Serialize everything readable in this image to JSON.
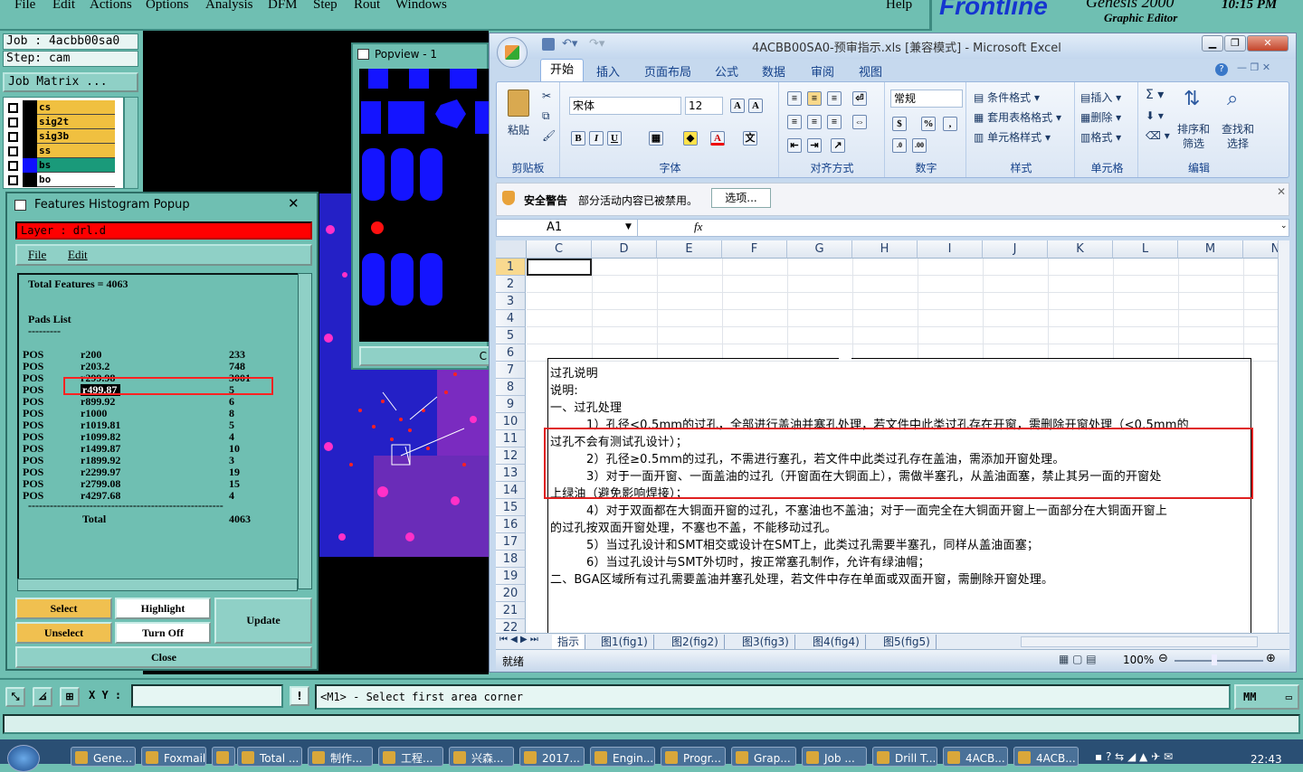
{
  "menubar": {
    "items": [
      "File",
      "Edit",
      "Actions",
      "Options",
      "Analysis",
      "DFM",
      "Step",
      "Rout",
      "Windows"
    ],
    "help": "Help"
  },
  "brand": {
    "logo": "Frontline",
    "product": "Genesis 2000",
    "subtitle": "Graphic Editor",
    "time": "10:15 PM"
  },
  "job": {
    "job": "Job : 4acbb00sa0",
    "step": "Step: cam",
    "matrix_button": "Job Matrix ...",
    "layers": [
      {
        "name": "cs",
        "swatch": "#000000",
        "bg": "#f0c040"
      },
      {
        "name": "sig2t",
        "swatch": "#000000",
        "bg": "#f0c040"
      },
      {
        "name": "sig3b",
        "swatch": "#000000",
        "bg": "#f0c040"
      },
      {
        "name": "ss",
        "swatch": "#000000",
        "bg": "#f0c040"
      },
      {
        "name": "bs",
        "swatch": "#1010ff",
        "bg": "#1a9a7a"
      },
      {
        "name": "bo",
        "swatch": "#000000",
        "bg": "#ffffff"
      }
    ]
  },
  "popview": {
    "title": "Popview - 1",
    "scroll_label": "C"
  },
  "histogram": {
    "title": "Features Histogram Popup",
    "layer": "Layer : drl.d",
    "menu": [
      "File",
      "Edit"
    ],
    "total_features": "Total Features = 4063",
    "section": "Pads List",
    "separator_short": "---------",
    "rows": [
      {
        "type": "POS",
        "sym": "r200",
        "count": "233"
      },
      {
        "type": "POS",
        "sym": "r203.2",
        "count": "748"
      },
      {
        "type": "POS",
        "sym": "r299.98",
        "count": "3001"
      },
      {
        "type": "POS",
        "sym": "r499.87",
        "count": "5"
      },
      {
        "type": "POS",
        "sym": "r899.92",
        "count": "6"
      },
      {
        "type": "POS",
        "sym": "r1000",
        "count": "8"
      },
      {
        "type": "POS",
        "sym": "r1019.81",
        "count": "5"
      },
      {
        "type": "POS",
        "sym": "r1099.82",
        "count": "4"
      },
      {
        "type": "POS",
        "sym": "r1499.87",
        "count": "10"
      },
      {
        "type": "POS",
        "sym": "r1899.92",
        "count": "3"
      },
      {
        "type": "POS",
        "sym": "r2299.97",
        "count": "19"
      },
      {
        "type": "POS",
        "sym": "r2799.08",
        "count": "15"
      },
      {
        "type": "POS",
        "sym": "r4297.68",
        "count": "4"
      }
    ],
    "separator_long": "------------------------------------------------------",
    "total_label": "Total",
    "total_value": "4063",
    "buttons": {
      "select": "Select",
      "highlight": "Highlight",
      "update": "Update",
      "unselect": "Unselect",
      "turn_off": "Turn Off",
      "close": "Close"
    },
    "highlight_color": "#ff2222"
  },
  "statusrow": {
    "xy_label": "X Y :",
    "xy_value": "",
    "warn": "!",
    "message": "<M1> - Select first area corner",
    "units": "MM"
  },
  "excel": {
    "title": "4ACBB00SA0-预审指示.xls [兼容模式] - Microsoft Excel",
    "tabs": [
      "开始",
      "插入",
      "页面布局",
      "公式",
      "数据",
      "审阅",
      "视图"
    ],
    "groups": {
      "clipboard": "剪贴板",
      "paste": "粘贴",
      "font": "字体",
      "font_name": "宋体",
      "font_size": "12",
      "align": "对齐方式",
      "number": "数字",
      "number_format": "常规",
      "styles": "样式",
      "cond_format": "条件格式",
      "table_format": "套用表格格式",
      "cell_styles": "单元格样式",
      "cells": "单元格",
      "insert": "插入",
      "delete": "删除",
      "format": "格式",
      "editing": "编辑",
      "sort": "排序和筛选",
      "find": "查找和选择"
    },
    "security": {
      "label": "安全警告",
      "text": "部分活动内容已被禁用。",
      "button": "选项..."
    },
    "name_box": "A1",
    "fx": "fx",
    "columns": [
      "C",
      "D",
      "E",
      "F",
      "G",
      "H",
      "I",
      "J",
      "K",
      "L",
      "M",
      "N"
    ],
    "rows": [
      "1",
      "2",
      "3",
      "4",
      "5",
      "6",
      "7",
      "8",
      "9",
      "10",
      "11",
      "12",
      "13",
      "14",
      "15",
      "16",
      "17",
      "18",
      "19",
      "20",
      "21",
      "22"
    ],
    "cells": {
      "r7": "过孔说明",
      "r8": "说明:",
      "r9": "一、过孔处理",
      "r10": "1）孔径<0.5mm的过孔，全部进行盖油并塞孔处理，若文件中此类过孔存在开窗，需删除开窗处理（<0.5mm的",
      "r11": "过孔不会有测试孔设计）；",
      "r12": "2）孔径≥0.5mm的过孔，不需进行塞孔，若文件中此类过孔存在盖油，需添加开窗处理。",
      "r13": "3）对于一面开窗、一面盖油的过孔（开窗面在大铜面上），需做半塞孔，从盖油面塞，禁止其另一面的开窗处",
      "r14": "上绿油（避免影响焊接）；",
      "r15": "4）对于双面都在大铜面开窗的过孔，不塞油也不盖油；对于一面完全在大铜面开窗上一面部分在大铜面开窗上",
      "r16": "的过孔按双面开窗处理，不塞也不盖，不能移动过孔。",
      "r17": "5）当过孔设计和SMT相交或设计在SMT上，此类过孔需要半塞孔，同样从盖油面塞；",
      "r18": "6）当过孔设计与SMT外切时，按正常塞孔制作，允许有绿油帽；",
      "r19": "二、BGA区域所有过孔需要盖油并塞孔处理，若文件中存在单面或双面开窗，需删除开窗处理。"
    },
    "sheet_tabs": [
      "指示",
      "图1(fig1)",
      "图2(fig2)",
      "图3(fig3)",
      "图4(fig4)",
      "图5(fig5)"
    ],
    "status": "就绪",
    "zoom": "100%"
  },
  "taskbar": {
    "items": [
      "Gene...",
      "Foxmail",
      "",
      "Total ...",
      "制作...",
      "工程...",
      "兴森...",
      "2017...",
      "Engin...",
      "Progr...",
      "Grap...",
      "Job ...",
      "Drill T...",
      "4ACB...",
      "4ACB..."
    ],
    "clock": "22:43"
  }
}
